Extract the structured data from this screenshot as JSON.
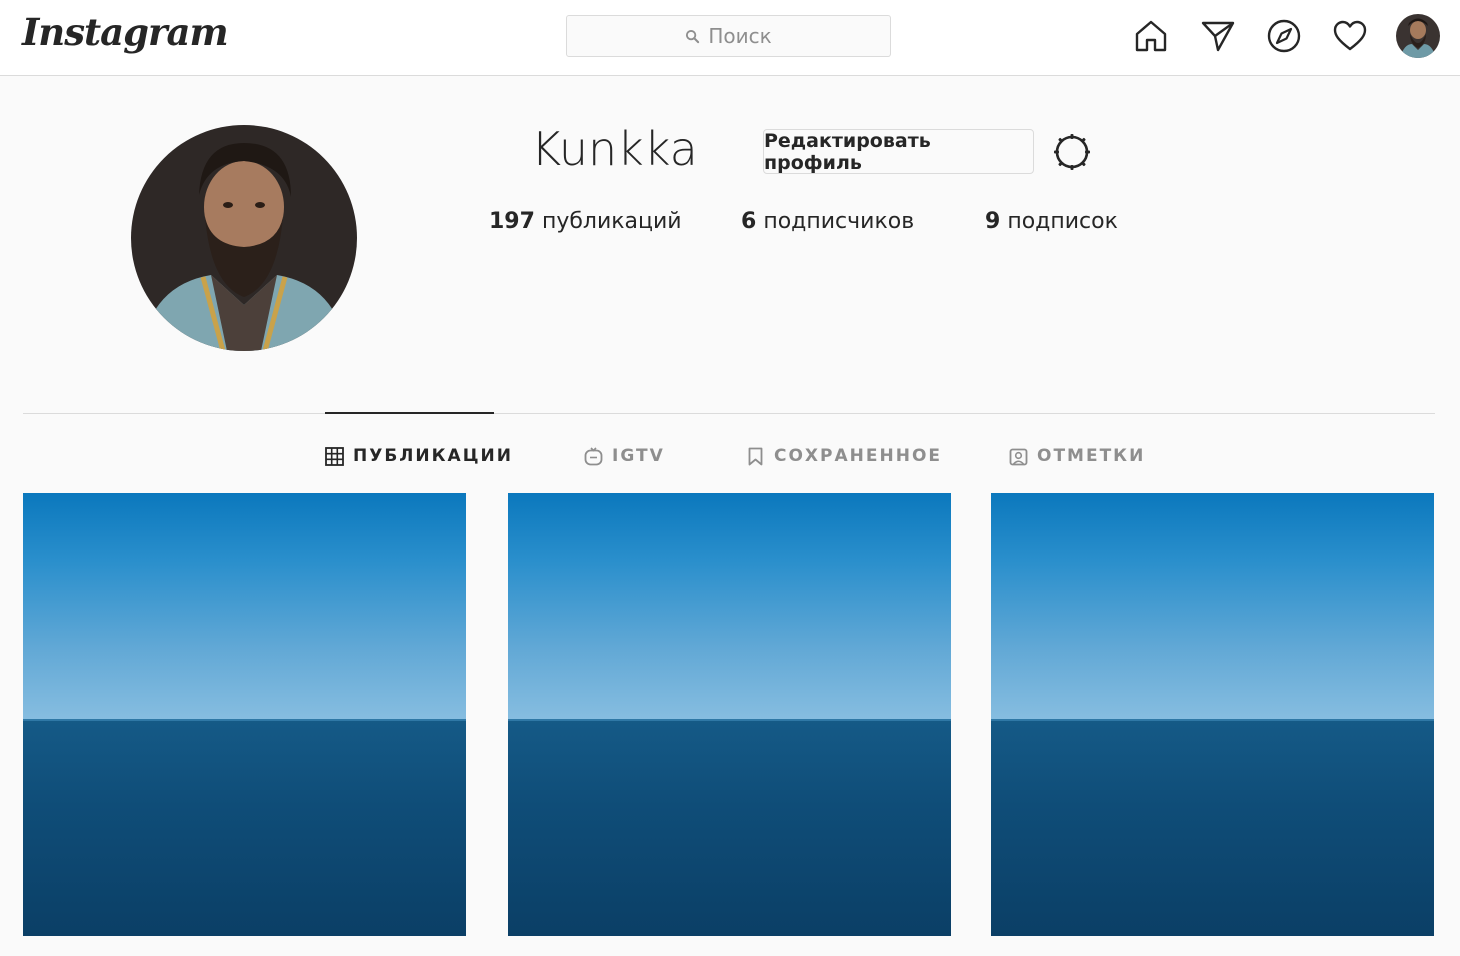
{
  "header": {
    "logo_text": "Instagram",
    "search_placeholder": "Поиск"
  },
  "nav_icons": [
    "home-icon",
    "direct-message-icon",
    "explore-compass-icon",
    "activity-heart-icon",
    "profile-avatar"
  ],
  "profile": {
    "username": "Kunkka",
    "edit_button_label": "Редактировать профиль",
    "stats": {
      "posts_count": "197",
      "posts_label": "публикаций",
      "followers_count": "6",
      "followers_label": "подписчиков",
      "following_count": "9",
      "following_label": "подписок"
    }
  },
  "tabs": [
    {
      "label": "ПУБЛИКАЦИИ",
      "icon": "grid-icon",
      "active": true
    },
    {
      "label": "IGTV",
      "icon": "igtv-icon",
      "active": false
    },
    {
      "label": "СОХРАНЕННОЕ",
      "icon": "bookmark-icon",
      "active": false
    },
    {
      "label": "ОТМЕТКИ",
      "icon": "tagged-person-icon",
      "active": false
    }
  ],
  "posts_visible": 3,
  "colors": {
    "text": "#262626",
    "muted": "#8e8e8e",
    "border": "#dbdbdb",
    "sky": "#2a8fcc",
    "sea": "#0f4d78"
  }
}
